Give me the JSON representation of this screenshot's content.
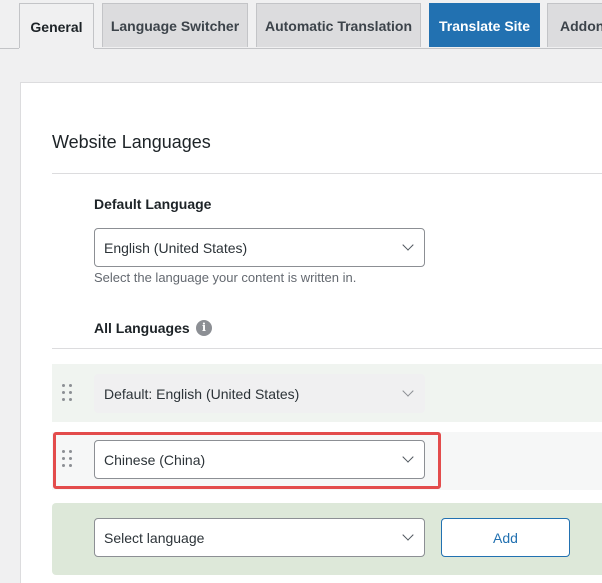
{
  "tabs": [
    {
      "label": "General",
      "state": "active"
    },
    {
      "label": "Language Switcher",
      "state": "normal"
    },
    {
      "label": "Automatic Translation",
      "state": "normal"
    },
    {
      "label": "Translate Site",
      "state": "primary"
    },
    {
      "label": "Addon",
      "state": "normal"
    }
  ],
  "section": {
    "title": "Website Languages"
  },
  "default_language": {
    "label": "Default Language",
    "value": "English (United States)",
    "help": "Select the language your content is written in."
  },
  "all_languages": {
    "label": "All Languages",
    "info_icon": "i",
    "rows": [
      {
        "value": "Default: English (United States)",
        "disabled": true
      },
      {
        "value": "Chinese (China)",
        "disabled": false
      }
    ],
    "new_language": {
      "placeholder": "Select language",
      "add_label": "Add"
    }
  },
  "colors": {
    "primary": "#2271b1",
    "highlight": "#e34c4c",
    "add_row_bg": "#dde8d9"
  }
}
